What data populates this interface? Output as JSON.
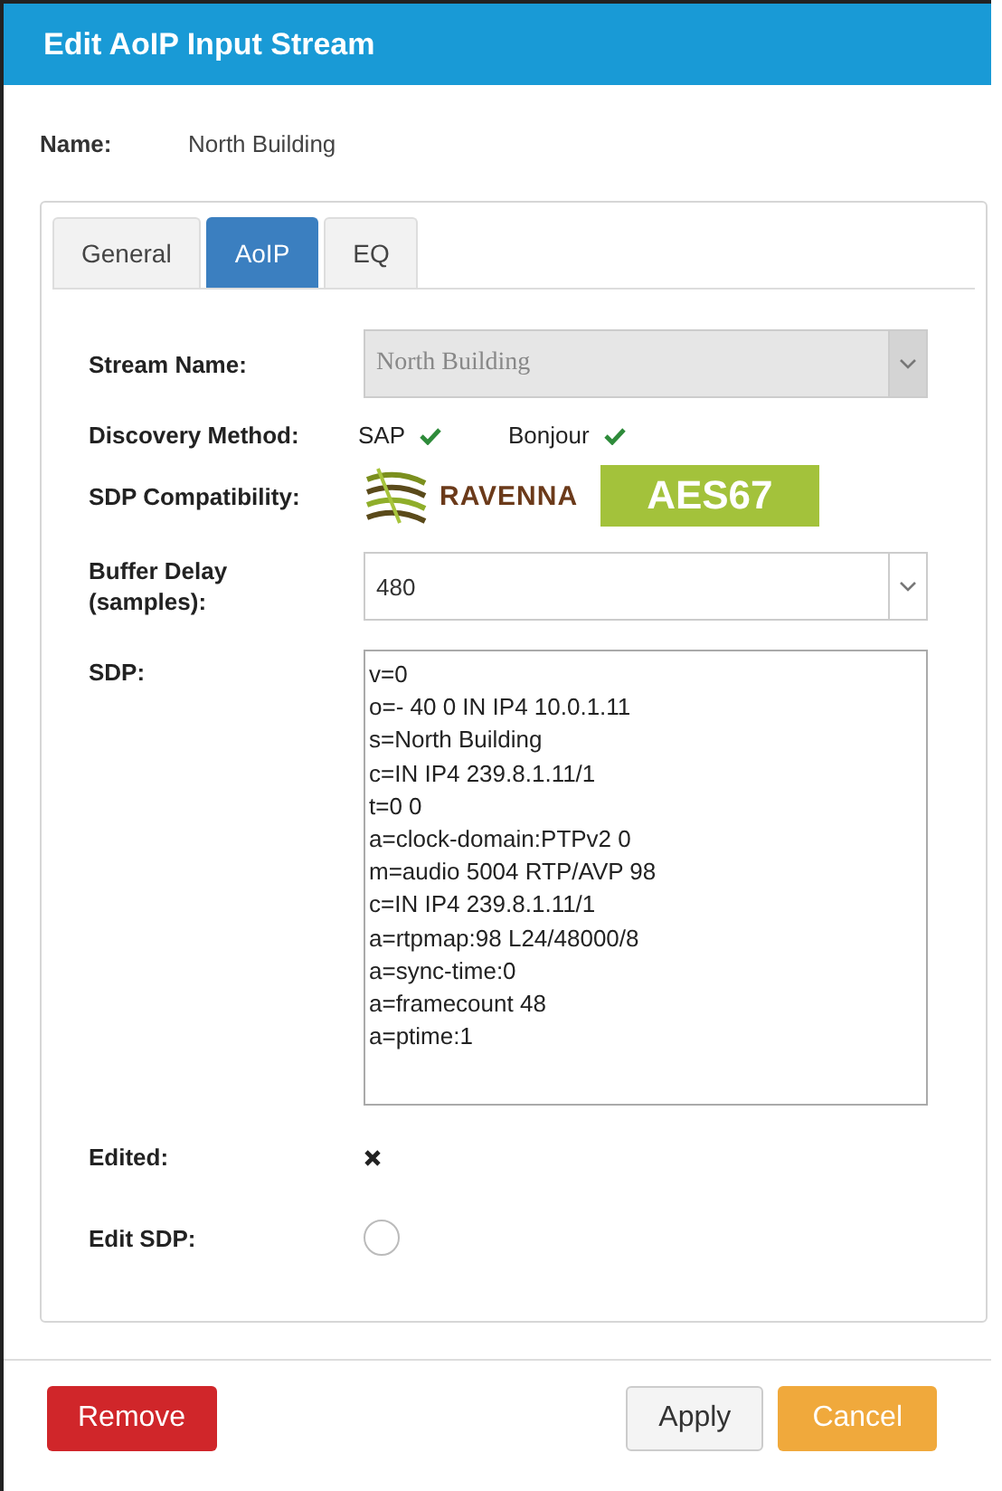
{
  "window": {
    "title": "Edit AoIP Input Stream"
  },
  "name": {
    "label": "Name:",
    "value": "North Building"
  },
  "tabs": [
    {
      "label": "General",
      "selected": false
    },
    {
      "label": "AoIP",
      "selected": true
    },
    {
      "label": "EQ",
      "selected": false
    }
  ],
  "stream_name": {
    "label": "Stream Name:",
    "value": "North Building",
    "disabled": true
  },
  "discovery": {
    "label": "Discovery Method:",
    "methods": [
      {
        "label": "SAP",
        "checked": true
      },
      {
        "label": "Bonjour",
        "checked": true
      }
    ]
  },
  "sdp_compatibility": {
    "label": "SDP Compatibility:",
    "logos": [
      {
        "kind": "ravenna",
        "text": "RAVENNA"
      },
      {
        "kind": "aes67",
        "text": "AES67"
      }
    ]
  },
  "buffer_delay": {
    "label_lines": [
      "Buffer Delay",
      "(samples):"
    ],
    "value": "480"
  },
  "sdp": {
    "label": "SDP:",
    "lines": [
      "v=0",
      "o=- 40 0 IN IP4 10.0.1.11",
      "s=North Building",
      "c=IN IP4 239.8.1.11/1",
      "t=0 0",
      "a=clock-domain:PTPv2 0",
      "m=audio 5004 RTP/AVP 98",
      "c=IN IP4 239.8.1.11/1",
      "a=rtpmap:98 L24/48000/8",
      "a=sync-time:0",
      "a=framecount 48",
      "a=ptime:1"
    ]
  },
  "edited": {
    "label": "Edited:",
    "checked": false
  },
  "edit_sdp": {
    "label": "Edit SDP:",
    "selected": false
  },
  "buttons": [
    {
      "kind": "danger",
      "label": "Remove"
    },
    {
      "kind": "default",
      "label": "Apply"
    },
    {
      "kind": "warning",
      "label": "Cancel"
    }
  ]
}
